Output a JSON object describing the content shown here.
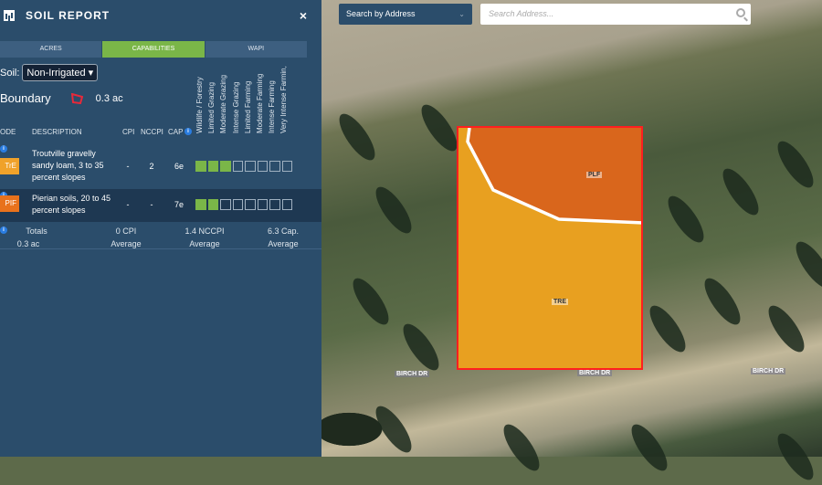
{
  "panel": {
    "title": "SOIL REPORT",
    "close_label": "×",
    "tabs": [
      {
        "label": "ACRES"
      },
      {
        "label": "CAPABILITIES",
        "active": true
      },
      {
        "label": "WAPI"
      }
    ],
    "soil_label": "Soil:",
    "soil_select": "Non-Irrigated ▾",
    "boundary_label": "Boundary",
    "boundary_acres": "0.3 ac",
    "capability_headers": [
      "Wildlife / Forestry",
      "Limited Grazing",
      "Moderate Grazing",
      "Intense Grazing",
      "Limited Farming",
      "Moderate Farming",
      "Intense Farming",
      "Very Intense Farmin,"
    ],
    "columns": {
      "code": "ODE",
      "description": "DESCRIPTION",
      "cpi": "CPI",
      "nccpi": "NCCPI",
      "cap": "CAP"
    },
    "rows": [
      {
        "code": "TrE",
        "color": "#f0a22a",
        "description": "Troutville gravelly sandy loam, 3 to 35 percent slopes",
        "cpi": "-",
        "nccpi": "2",
        "cap": "6e",
        "filled": 3
      },
      {
        "code": "PIF",
        "color": "#e8721c",
        "description": "Pierian soils, 20 to 45 percent slopes",
        "cpi": "-",
        "nccpi": "-",
        "cap": "7e",
        "filled": 2
      }
    ],
    "totals": {
      "label": "Totals",
      "acres": "0.3 ac",
      "cpi": "0 CPI",
      "cpi_sub": "Average",
      "nccpi": "1.4 NCCPI",
      "nccpi_sub": "Average",
      "cap": "6.3 Cap.",
      "cap_sub": "Average"
    }
  },
  "search": {
    "mode": "Search by Address",
    "placeholder": "Search Address..."
  },
  "map": {
    "labels": {
      "plf": "PLF",
      "tre": "TRE"
    },
    "roads": [
      "BIRCH DR",
      "BIRCH DR",
      "BIRCH DR"
    ]
  }
}
